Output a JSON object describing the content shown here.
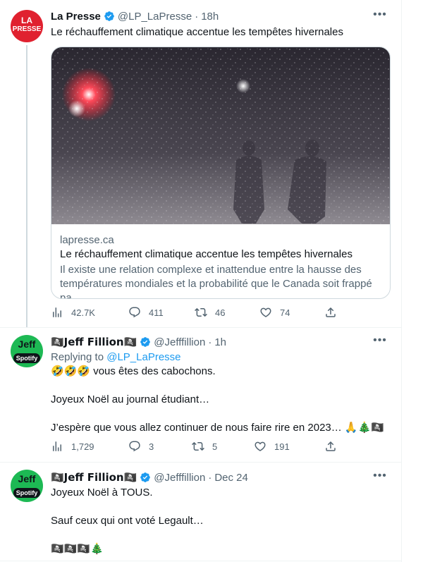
{
  "tweets": [
    {
      "author": "La Presse",
      "handle": "@LP_LaPresse",
      "time": "18h",
      "text": "Le réchauffement climatique accentue les tempêtes hivernales",
      "avatar_text": [
        "LA",
        "PRESSE"
      ],
      "card": {
        "domain": "lapresse.ca",
        "title": "Le réchauffement climatique accentue les tempêtes hivernales",
        "description": "Il existe une relation complexe et inattendue entre la hausse des températures mondiales et la probabilité que le Canada soit frappé pa..."
      },
      "stats": {
        "views": "42.7K",
        "replies": "411",
        "retweets": "46",
        "likes": "74"
      }
    },
    {
      "author": "🏴‍☠️Jeff Fillion🏴‍☠️",
      "handle": "@Jefffillion",
      "time": "1h",
      "reply_prefix": "Replying to ",
      "reply_handle": "@LP_LaPresse",
      "avatar_text": [
        "Jeff",
        "Spotify"
      ],
      "text": "🤣🤣🤣 vous êtes des cabochons.\n\nJoyeux Noël au journal étudiant…\n\nJ’espère que vous allez continuer de nous faire rire en 2023… 🙏🎄🏴‍☠️",
      "stats": {
        "views": "1,729",
        "replies": "3",
        "retweets": "5",
        "likes": "191"
      }
    },
    {
      "author": "🏴‍☠️Jeff Fillion🏴‍☠️",
      "handle": "@Jefffillion",
      "time": "Dec 24",
      "avatar_text": [
        "Jeff",
        "Spotify"
      ],
      "text": "Joyeux Noël à TOUS.\n\nSauf ceux qui ont voté Legault…\n\n🏴‍☠️🏴‍☠️🏴‍☠️🎄"
    }
  ],
  "colors": {
    "accent": "#1d9bf0",
    "secondary": "#536471",
    "lapresse_red": "#e0212f",
    "spotify_green": "#1db954"
  },
  "icons": [
    "more-icon",
    "verified-icon",
    "views-icon",
    "reply-icon",
    "retweet-icon",
    "like-icon",
    "share-icon"
  ]
}
